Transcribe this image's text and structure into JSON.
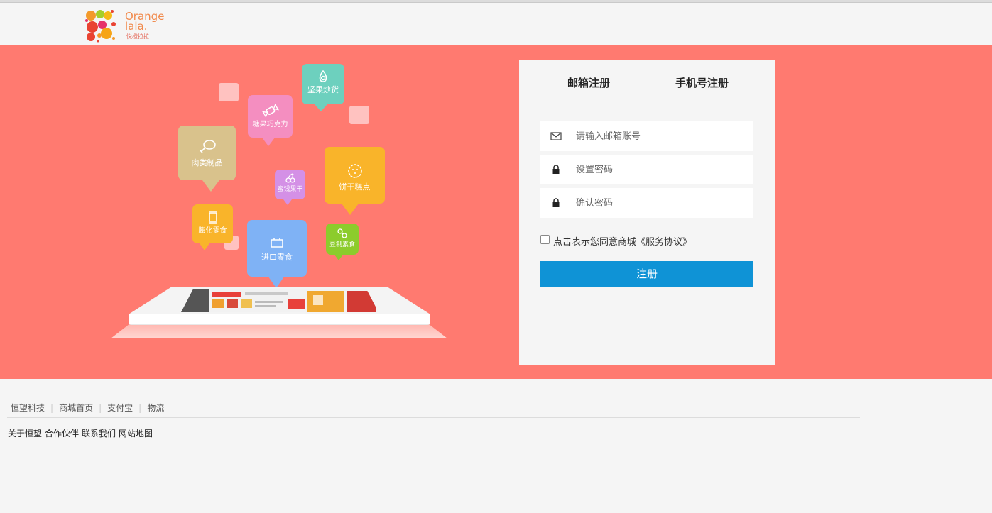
{
  "header": {
    "logo_line1": "Orange",
    "logo_line2": "lala.",
    "logo_sub": "悦橙拉拉"
  },
  "banner": {
    "bg_color": "#ff7a70",
    "categories": [
      {
        "label": "坚果炒货",
        "color": "#6dd0be",
        "icon": "seed-icon"
      },
      {
        "label": "糖果巧克力",
        "color": "#f48ec0",
        "icon": "candy-icon"
      },
      {
        "label": "肉类制品",
        "color": "#d9c28c",
        "icon": "drumstick-icon"
      },
      {
        "label": "饼干糕点",
        "color": "#f9b42a",
        "icon": "cookie-icon"
      },
      {
        "label": "蜜饯果干",
        "color": "#d490e6",
        "icon": "cherry-icon"
      },
      {
        "label": "膨化零食",
        "color": "#f9b42a",
        "icon": "snack-bag-icon"
      },
      {
        "label": "进口零食",
        "color": "#7fb2f5",
        "icon": "package-icon"
      },
      {
        "label": "豆制素食",
        "color": "#8ccc2c",
        "icon": "beans-icon"
      }
    ]
  },
  "register": {
    "tab_email": "邮箱注册",
    "tab_phone": "手机号注册",
    "email_placeholder": "请输入邮箱账号",
    "password_placeholder": "设置密码",
    "confirm_placeholder": "确认密码",
    "agree_text": "点击表示您同意商城《服务协议》",
    "submit_label": "注册",
    "submit_color": "#0f93d6"
  },
  "footer": {
    "links": [
      "恒望科技",
      "商城首页",
      "支付宝",
      "物流"
    ],
    "sub_links": [
      "关于恒望",
      "合作伙伴",
      "联系我们",
      "网站地图"
    ]
  }
}
